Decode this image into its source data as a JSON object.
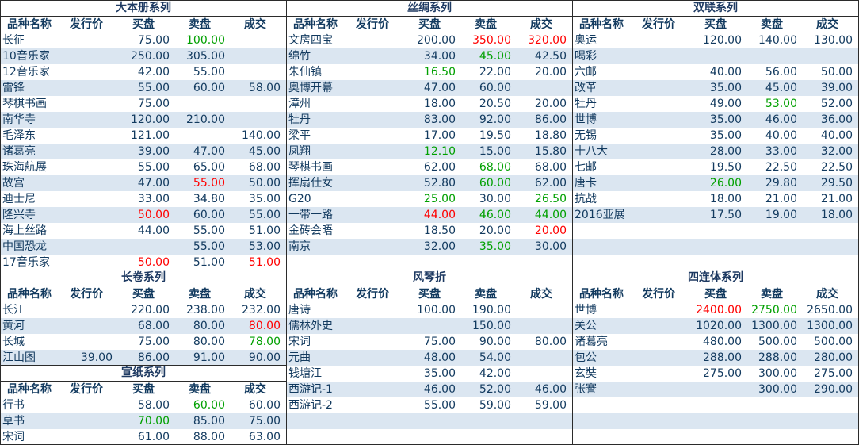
{
  "colors": {
    "up": "#ff0000",
    "down": "#00a000",
    "normal": "#123a5f",
    "stripe": "#dbe6f1"
  },
  "headers": [
    "品种名称",
    "发行价",
    "买盘",
    "卖盘",
    "成交"
  ],
  "panels": [
    {
      "id": "dabence",
      "title": "大本册系列",
      "rows": [
        {
          "name": "长征",
          "issue": "",
          "buy": "75.00",
          "sell": "100.00",
          "deal": "",
          "c": [
            "",
            "",
            "",
            "down",
            ""
          ]
        },
        {
          "name": "10音乐家",
          "issue": "",
          "buy": "250.00",
          "sell": "305.00",
          "deal": "",
          "c": [
            "",
            "",
            "",
            "",
            ""
          ]
        },
        {
          "name": "12音乐家",
          "issue": "",
          "buy": "42.00",
          "sell": "55.00",
          "deal": "",
          "c": [
            "",
            "",
            "",
            "",
            ""
          ]
        },
        {
          "name": "雷锋",
          "issue": "",
          "buy": "55.00",
          "sell": "60.00",
          "deal": "58.00",
          "c": [
            "",
            "",
            "",
            "",
            ""
          ]
        },
        {
          "name": "琴棋书画",
          "issue": "",
          "buy": "75.00",
          "sell": "",
          "deal": "",
          "c": [
            "",
            "",
            "",
            "",
            ""
          ]
        },
        {
          "name": "南华寺",
          "issue": "",
          "buy": "120.00",
          "sell": "210.00",
          "deal": "",
          "c": [
            "",
            "",
            "",
            "",
            ""
          ]
        },
        {
          "name": "毛泽东",
          "issue": "",
          "buy": "121.00",
          "sell": "",
          "deal": "140.00",
          "c": [
            "",
            "",
            "",
            "",
            ""
          ]
        },
        {
          "name": "诸葛亮",
          "issue": "",
          "buy": "39.00",
          "sell": "47.00",
          "deal": "45.00",
          "c": [
            "",
            "",
            "",
            "",
            ""
          ]
        },
        {
          "name": "珠海航展",
          "issue": "",
          "buy": "55.00",
          "sell": "65.00",
          "deal": "68.00",
          "c": [
            "",
            "",
            "",
            "",
            ""
          ]
        },
        {
          "name": "故宫",
          "issue": "",
          "buy": "47.00",
          "sell": "55.00",
          "deal": "50.00",
          "c": [
            "",
            "",
            "",
            "up",
            ""
          ]
        },
        {
          "name": "迪士尼",
          "issue": "",
          "buy": "33.00",
          "sell": "34.80",
          "deal": "35.00",
          "c": [
            "",
            "",
            "",
            "",
            ""
          ]
        },
        {
          "name": "隆兴寺",
          "issue": "",
          "buy": "50.00",
          "sell": "60.00",
          "deal": "55.00",
          "c": [
            "",
            "",
            "up",
            "",
            ""
          ]
        },
        {
          "name": "海上丝路",
          "issue": "",
          "buy": "44.00",
          "sell": "55.00",
          "deal": "51.00",
          "c": [
            "",
            "",
            "",
            "",
            ""
          ]
        },
        {
          "name": "中国恐龙",
          "issue": "",
          "buy": "",
          "sell": "55.00",
          "deal": "53.00",
          "c": [
            "",
            "",
            "",
            "",
            ""
          ]
        },
        {
          "name": "17音乐家",
          "issue": "",
          "buy": "50.00",
          "sell": "51.00",
          "deal": "51.00",
          "c": [
            "",
            "",
            "up",
            "",
            "up"
          ]
        }
      ]
    },
    {
      "id": "sichou",
      "title": "丝绸系列",
      "rows": [
        {
          "name": "文房四宝",
          "issue": "",
          "buy": "200.00",
          "sell": "350.00",
          "deal": "320.00",
          "c": [
            "",
            "",
            "",
            "up",
            "up"
          ]
        },
        {
          "name": "绵竹",
          "issue": "",
          "buy": "34.00",
          "sell": "45.00",
          "deal": "42.50",
          "c": [
            "",
            "",
            "",
            "down",
            ""
          ]
        },
        {
          "name": "朱仙镇",
          "issue": "",
          "buy": "16.50",
          "sell": "22.00",
          "deal": "20.00",
          "c": [
            "",
            "",
            "down",
            "",
            ""
          ]
        },
        {
          "name": "奥博开幕",
          "issue": "",
          "buy": "47.00",
          "sell": "60.00",
          "deal": "",
          "c": [
            "",
            "",
            "",
            "",
            ""
          ]
        },
        {
          "name": "漳州",
          "issue": "",
          "buy": "18.00",
          "sell": "20.50",
          "deal": "20.00",
          "c": [
            "",
            "",
            "",
            "",
            ""
          ]
        },
        {
          "name": "牡丹",
          "issue": "",
          "buy": "83.00",
          "sell": "92.00",
          "deal": "86.00",
          "c": [
            "",
            "",
            "",
            "",
            ""
          ]
        },
        {
          "name": "梁平",
          "issue": "",
          "buy": "17.00",
          "sell": "19.50",
          "deal": "18.80",
          "c": [
            "",
            "",
            "",
            "",
            ""
          ]
        },
        {
          "name": "凤翔",
          "issue": "",
          "buy": "12.10",
          "sell": "15.00",
          "deal": "15.80",
          "c": [
            "",
            "",
            "down",
            "",
            ""
          ]
        },
        {
          "name": "琴棋书画",
          "issue": "",
          "buy": "62.00",
          "sell": "68.00",
          "deal": "68.00",
          "c": [
            "",
            "",
            "",
            "down",
            ""
          ]
        },
        {
          "name": "挥扇仕女",
          "issue": "",
          "buy": "52.80",
          "sell": "60.00",
          "deal": "62.00",
          "c": [
            "",
            "",
            "",
            "down",
            ""
          ]
        },
        {
          "name": "G20",
          "issue": "",
          "buy": "25.00",
          "sell": "30.00",
          "deal": "26.50",
          "c": [
            "",
            "",
            "down",
            "",
            "down"
          ]
        },
        {
          "name": "一带一路",
          "issue": "",
          "buy": "44.00",
          "sell": "46.00",
          "deal": "44.00",
          "c": [
            "",
            "",
            "up",
            "down",
            "down"
          ]
        },
        {
          "name": "金砖会晤",
          "issue": "",
          "buy": "18.50",
          "sell": "20.00",
          "deal": "20.00",
          "c": [
            "",
            "",
            "",
            "",
            "up"
          ]
        },
        {
          "name": "南京",
          "issue": "",
          "buy": "32.00",
          "sell": "35.00",
          "deal": "30.00",
          "c": [
            "",
            "",
            "",
            "down",
            ""
          ]
        },
        {
          "name": "",
          "issue": "",
          "buy": "",
          "sell": "",
          "deal": "",
          "c": [
            "",
            "",
            "",
            "",
            ""
          ]
        }
      ]
    },
    {
      "id": "shuanglian",
      "title": "双联系列",
      "rows": [
        {
          "name": "奥运",
          "issue": "",
          "buy": "120.00",
          "sell": "140.00",
          "deal": "130.00",
          "c": [
            "",
            "",
            "",
            "",
            ""
          ]
        },
        {
          "name": "喝彩",
          "issue": "",
          "buy": "",
          "sell": "",
          "deal": "",
          "c": [
            "",
            "",
            "",
            "",
            ""
          ]
        },
        {
          "name": "六邮",
          "issue": "",
          "buy": "40.00",
          "sell": "56.00",
          "deal": "50.00",
          "c": [
            "",
            "",
            "",
            "",
            ""
          ]
        },
        {
          "name": "改革",
          "issue": "",
          "buy": "35.00",
          "sell": "45.00",
          "deal": "39.00",
          "c": [
            "",
            "",
            "",
            "",
            ""
          ]
        },
        {
          "name": "牡丹",
          "issue": "",
          "buy": "49.00",
          "sell": "53.00",
          "deal": "52.00",
          "c": [
            "",
            "",
            "",
            "down",
            ""
          ]
        },
        {
          "name": "世博",
          "issue": "",
          "buy": "35.00",
          "sell": "46.00",
          "deal": "36.00",
          "c": [
            "",
            "",
            "",
            "",
            ""
          ]
        },
        {
          "name": "无锡",
          "issue": "",
          "buy": "35.00",
          "sell": "40.00",
          "deal": "40.00",
          "c": [
            "",
            "",
            "",
            "",
            ""
          ]
        },
        {
          "name": "十八大",
          "issue": "",
          "buy": "28.00",
          "sell": "33.00",
          "deal": "32.00",
          "c": [
            "",
            "",
            "",
            "",
            ""
          ]
        },
        {
          "name": "七邮",
          "issue": "",
          "buy": "19.50",
          "sell": "22.50",
          "deal": "22.50",
          "c": [
            "",
            "",
            "",
            "",
            ""
          ]
        },
        {
          "name": "唐卡",
          "issue": "",
          "buy": "26.00",
          "sell": "29.80",
          "deal": "29.50",
          "c": [
            "",
            "",
            "down",
            "",
            ""
          ]
        },
        {
          "name": "抗战",
          "issue": "",
          "buy": "18.00",
          "sell": "21.00",
          "deal": "21.00",
          "c": [
            "",
            "",
            "",
            "",
            ""
          ]
        },
        {
          "name": "2016亚展",
          "issue": "",
          "buy": "17.50",
          "sell": "19.00",
          "deal": "18.00",
          "c": [
            "",
            "",
            "",
            "",
            ""
          ]
        },
        {
          "name": "",
          "issue": "",
          "buy": "",
          "sell": "",
          "deal": "",
          "c": [
            "",
            "",
            "",
            "",
            ""
          ]
        },
        {
          "name": "",
          "issue": "",
          "buy": "",
          "sell": "",
          "deal": "",
          "c": [
            "",
            "",
            "",
            "",
            ""
          ]
        },
        {
          "name": "",
          "issue": "",
          "buy": "",
          "sell": "",
          "deal": "",
          "c": [
            "",
            "",
            "",
            "",
            ""
          ]
        }
      ]
    },
    {
      "id": "changjuan",
      "title": "长卷系列",
      "rows": [
        {
          "name": "长江",
          "issue": "",
          "buy": "220.00",
          "sell": "238.00",
          "deal": "232.00",
          "c": [
            "",
            "",
            "",
            "",
            ""
          ]
        },
        {
          "name": "黄河",
          "issue": "",
          "buy": "68.00",
          "sell": "80.00",
          "deal": "80.00",
          "c": [
            "",
            "",
            "",
            "",
            "up"
          ]
        },
        {
          "name": "长城",
          "issue": "",
          "buy": "75.00",
          "sell": "80.00",
          "deal": "78.00",
          "c": [
            "",
            "",
            "",
            "",
            "down"
          ]
        },
        {
          "name": "江山图",
          "issue": "39.00",
          "buy": "86.00",
          "sell": "91.00",
          "deal": "90.00",
          "c": [
            "",
            "",
            "",
            "",
            ""
          ]
        }
      ]
    },
    {
      "id": "xuanzhi",
      "title": "宣纸系列",
      "rows": [
        {
          "name": "行书",
          "issue": "",
          "buy": "58.00",
          "sell": "60.00",
          "deal": "60.00",
          "c": [
            "",
            "",
            "",
            "down",
            ""
          ]
        },
        {
          "name": "草书",
          "issue": "",
          "buy": "70.00",
          "sell": "85.00",
          "deal": "75.00",
          "c": [
            "",
            "",
            "down",
            "",
            ""
          ]
        },
        {
          "name": "宋词",
          "issue": "",
          "buy": "61.00",
          "sell": "88.00",
          "deal": "63.00",
          "c": [
            "",
            "",
            "",
            "",
            ""
          ]
        }
      ]
    },
    {
      "id": "fengqinzhe",
      "title": "风琴折",
      "rows": [
        {
          "name": "唐诗",
          "issue": "",
          "buy": "100.00",
          "sell": "190.00",
          "deal": "",
          "c": [
            "",
            "",
            "",
            "",
            ""
          ]
        },
        {
          "name": "儒林外史",
          "issue": "",
          "buy": "",
          "sell": "150.00",
          "deal": "",
          "c": [
            "",
            "",
            "",
            "",
            ""
          ]
        },
        {
          "name": "宋词",
          "issue": "",
          "buy": "75.00",
          "sell": "90.00",
          "deal": "80.00",
          "c": [
            "",
            "",
            "",
            "",
            ""
          ]
        },
        {
          "name": "元曲",
          "issue": "",
          "buy": "48.00",
          "sell": "54.00",
          "deal": "",
          "c": [
            "",
            "",
            "",
            "",
            ""
          ]
        },
        {
          "name": "钱塘江",
          "issue": "",
          "buy": "35.00",
          "sell": "42.00",
          "deal": "",
          "c": [
            "",
            "",
            "",
            "",
            ""
          ]
        },
        {
          "name": "西游记-1",
          "issue": "",
          "buy": "46.00",
          "sell": "52.00",
          "deal": "46.00",
          "c": [
            "",
            "",
            "",
            "",
            ""
          ]
        },
        {
          "name": "西游记-2",
          "issue": "",
          "buy": "55.00",
          "sell": "59.00",
          "deal": "59.00",
          "c": [
            "",
            "",
            "",
            "",
            ""
          ]
        },
        {
          "name": "",
          "issue": "",
          "buy": "",
          "sell": "",
          "deal": "",
          "c": [
            "",
            "",
            "",
            "",
            ""
          ]
        },
        {
          "name": "",
          "issue": "",
          "buy": "",
          "sell": "",
          "deal": "",
          "c": [
            "",
            "",
            "",
            "",
            ""
          ]
        }
      ]
    },
    {
      "id": "siliantI",
      "title": "四连体系列",
      "rows": [
        {
          "name": "世博",
          "issue": "",
          "buy": "2400.00",
          "sell": "2750.00",
          "deal": "2650.00",
          "c": [
            "",
            "",
            "up",
            "down",
            ""
          ]
        },
        {
          "name": "关公",
          "issue": "",
          "buy": "1020.00",
          "sell": "1300.00",
          "deal": "1300.00",
          "c": [
            "",
            "",
            "",
            "",
            ""
          ]
        },
        {
          "name": "诸葛亮",
          "issue": "",
          "buy": "480.00",
          "sell": "500.00",
          "deal": "500.00",
          "c": [
            "",
            "",
            "",
            "",
            ""
          ]
        },
        {
          "name": "包公",
          "issue": "",
          "buy": "288.00",
          "sell": "288.00",
          "deal": "280.00",
          "c": [
            "",
            "",
            "",
            "",
            ""
          ]
        },
        {
          "name": "玄奘",
          "issue": "",
          "buy": "275.00",
          "sell": "300.00",
          "deal": "275.00",
          "c": [
            "",
            "",
            "",
            "",
            ""
          ]
        },
        {
          "name": "张謇",
          "issue": "",
          "buy": "",
          "sell": "300.00",
          "deal": "290.00",
          "c": [
            "",
            "",
            "",
            "",
            ""
          ]
        },
        {
          "name": "",
          "issue": "",
          "buy": "",
          "sell": "",
          "deal": "",
          "c": [
            "",
            "",
            "",
            "",
            ""
          ]
        },
        {
          "name": "",
          "issue": "",
          "buy": "",
          "sell": "",
          "deal": "",
          "c": [
            "",
            "",
            "",
            "",
            ""
          ]
        },
        {
          "name": "",
          "issue": "",
          "buy": "",
          "sell": "",
          "deal": "",
          "c": [
            "",
            "",
            "",
            "",
            ""
          ]
        }
      ]
    }
  ]
}
